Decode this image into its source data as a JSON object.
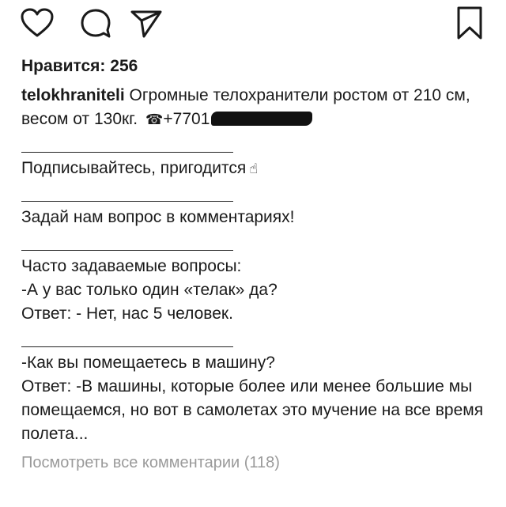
{
  "actions": {
    "like_icon": "heart-outline-icon",
    "comment_icon": "speech-bubble-icon",
    "share_icon": "paper-plane-icon",
    "save_icon": "bookmark-outline-icon"
  },
  "post": {
    "likes_label": "Нравится: 256",
    "username": "telokhraniteli",
    "caption_intro": " Огромные телохранители ростом от 210 см, весом от 130кг.",
    "phone_prefix": "+7701",
    "phone_icon": "telephone-icon",
    "separator": "____________________",
    "subscribe_text": "Подписывайтесь, пригодится",
    "subscribe_emoji": "☝",
    "ask_text": "Задай нам вопрос в комментариях!",
    "faq_title": "Часто задаваемые вопросы:",
    "q1": "-А у вас только один «телак» да?",
    "a1": "Ответ: - Нет, нас 5 человек.",
    "q2": "-Как вы помещаетесь в машину?",
    "a2": "Ответ: -В машины, которые более или менее большие мы помещаемся, но вот в самолетах это мучение на все время полета...",
    "view_comments": "Посмотреть все комментарии (118)"
  },
  "colors": {
    "text": "#1a1a1a",
    "muted": "#9a9a9a",
    "background": "#ffffff"
  }
}
